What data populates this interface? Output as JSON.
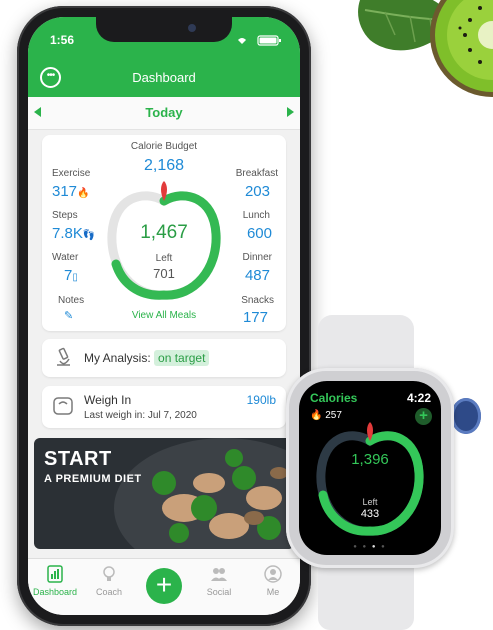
{
  "status": {
    "time": "1:56"
  },
  "header": {
    "title": "Dashboard"
  },
  "date_nav": {
    "label": "Today"
  },
  "summary": {
    "budget_label": "Calorie Budget",
    "budget_value": "2,168",
    "center_value": "1,467",
    "center_left_label": "Left",
    "center_left_value": "701",
    "view_meals": "View All Meals",
    "left_stats": [
      {
        "label": "Exercise",
        "value": "317"
      },
      {
        "label": "Steps",
        "value": "7.8K"
      },
      {
        "label": "Water",
        "value": "7"
      },
      {
        "label": "Notes",
        "value": ""
      }
    ],
    "right_stats": [
      {
        "label": "Breakfast",
        "value": "203"
      },
      {
        "label": "Lunch",
        "value": "600"
      },
      {
        "label": "Dinner",
        "value": "487"
      },
      {
        "label": "Snacks",
        "value": "177"
      }
    ]
  },
  "analysis": {
    "label": "My Analysis:",
    "status": "on target"
  },
  "weigh_in": {
    "title": "Weigh In",
    "last": "Last weigh in: Jul 7, 2020",
    "value": "190lb"
  },
  "banner": {
    "line1": "START",
    "line2": "A PREMIUM DIET"
  },
  "tabs": [
    {
      "label": "Dashboard",
      "icon": "chart-icon"
    },
    {
      "label": "Coach",
      "icon": "bulb-icon"
    },
    {
      "label": "",
      "icon": "plus-icon"
    },
    {
      "label": "Social",
      "icon": "people-icon"
    },
    {
      "label": "Me",
      "icon": "person-icon"
    }
  ],
  "watch": {
    "title": "Calories",
    "time": "4:22",
    "burned": "257",
    "value": "1,396",
    "left_label": "Left",
    "left_value": "433"
  },
  "colors": {
    "brand_green": "#2bb34b",
    "value_blue": "#1f8ad6",
    "watch_green": "#34c759"
  }
}
